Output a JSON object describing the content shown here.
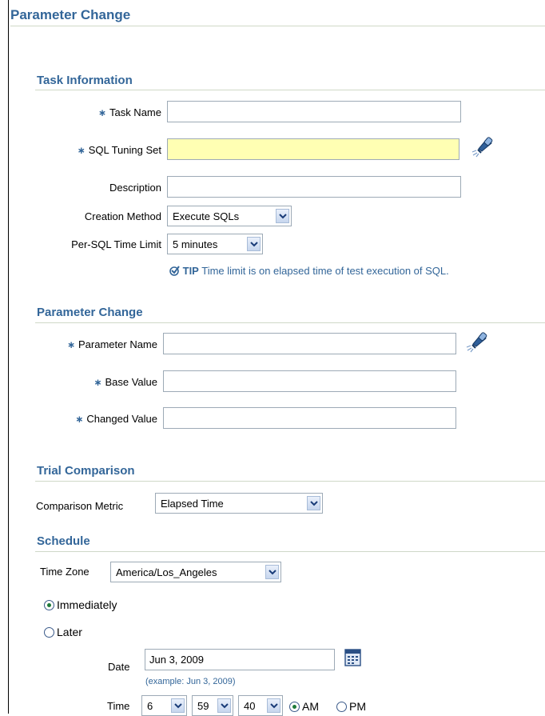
{
  "page": {
    "title": "Parameter Change"
  },
  "task_info": {
    "heading": "Task Information",
    "task_name": {
      "label": "Task Name",
      "value": ""
    },
    "sql_tuning_set": {
      "label": "SQL Tuning Set",
      "value": ""
    },
    "description": {
      "label": "Description",
      "value": ""
    },
    "creation_method": {
      "label": "Creation Method",
      "value": "Execute SQLs"
    },
    "time_limit": {
      "label": "Per-SQL Time Limit",
      "value": "5 minutes"
    },
    "tip": {
      "prefix": "TIP",
      "text": "Time limit is on elapsed time of test execution of SQL."
    }
  },
  "param_change": {
    "heading": "Parameter Change",
    "param_name": {
      "label": "Parameter Name",
      "value": ""
    },
    "base_value": {
      "label": "Base Value",
      "value": ""
    },
    "changed_value": {
      "label": "Changed Value",
      "value": ""
    }
  },
  "trial": {
    "heading": "Trial Comparison",
    "metric": {
      "label": "Comparison Metric",
      "value": "Elapsed Time"
    }
  },
  "schedule": {
    "heading": "Schedule",
    "time_zone": {
      "label": "Time Zone",
      "value": "America/Los_Angeles"
    },
    "immediately": "Immediately",
    "later": "Later",
    "date": {
      "label": "Date",
      "value": "Jun 3, 2009",
      "example": "(example: Jun 3, 2009)"
    },
    "time": {
      "label": "Time",
      "hour": "6",
      "minute": "59",
      "second": "40",
      "am": "AM",
      "pm": "PM"
    }
  },
  "colors": {
    "heading": "#336699",
    "highlight": "#ffffb3",
    "rule": "#cfd8c8"
  },
  "icons": [
    "required-asterisk-icon",
    "flashlight-search-icon",
    "tip-check-icon",
    "calendar-icon",
    "dropdown-arrow-icon"
  ]
}
